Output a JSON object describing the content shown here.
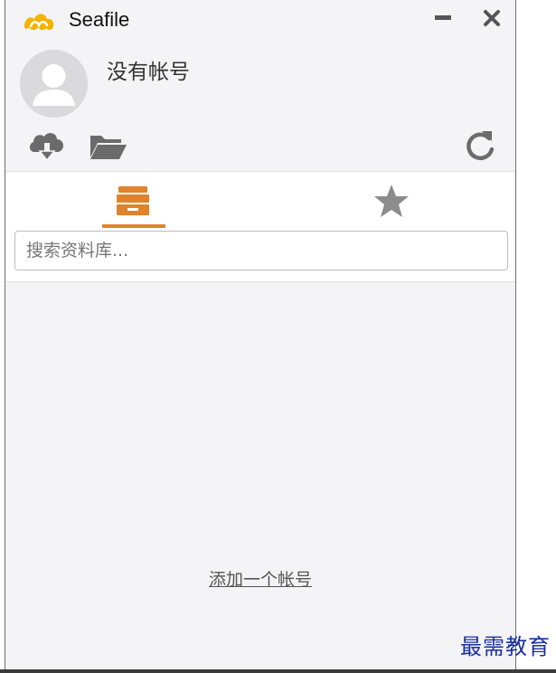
{
  "window": {
    "title": "Seafile"
  },
  "account": {
    "name": "没有帐号"
  },
  "search": {
    "placeholder": "搜索资料库..."
  },
  "footer": {
    "add_account": "添加一个帐号"
  },
  "watermark": {
    "text": "最需教育"
  },
  "colors": {
    "accent": "#e0832a",
    "logo": "#f5b300",
    "icon_gray": "#666666",
    "watermark": "#1a2fa0"
  },
  "icons": {
    "logo": "seafile-logo-icon",
    "minimize": "minimize-icon",
    "close": "close-icon",
    "avatar": "user-avatar-icon",
    "download": "cloud-download-icon",
    "folder": "folder-open-icon",
    "refresh": "refresh-icon",
    "repos_tab": "archive-box-icon",
    "starred_tab": "star-icon"
  }
}
